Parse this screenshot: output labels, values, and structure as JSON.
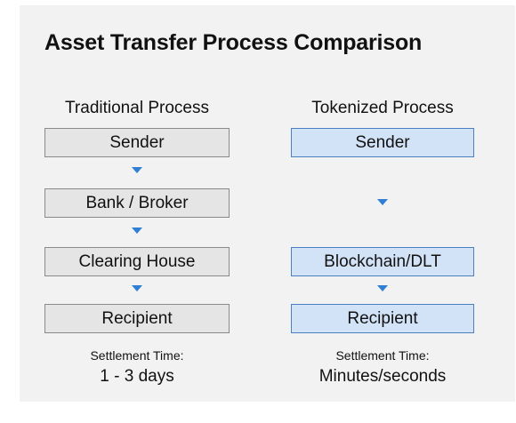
{
  "title": "Asset Transfer Process Comparison",
  "traditional": {
    "heading": "Traditional Process",
    "steps": [
      "Sender",
      "Bank / Broker",
      "Clearing House",
      "Recipient"
    ],
    "settlement_label": "Settlement Time:",
    "settlement_value": "1 - 3 days"
  },
  "tokenized": {
    "heading": "Tokenized Process",
    "steps": [
      "Sender",
      "Blockchain/DLT",
      "Recipient"
    ],
    "settlement_label": "Settlement Time:",
    "settlement_value": "Minutes/seconds"
  },
  "colors": {
    "traditional_box": "#e5e5e5",
    "tokenized_box": "#d3e3f7",
    "arrow": "#2f7fd6"
  }
}
